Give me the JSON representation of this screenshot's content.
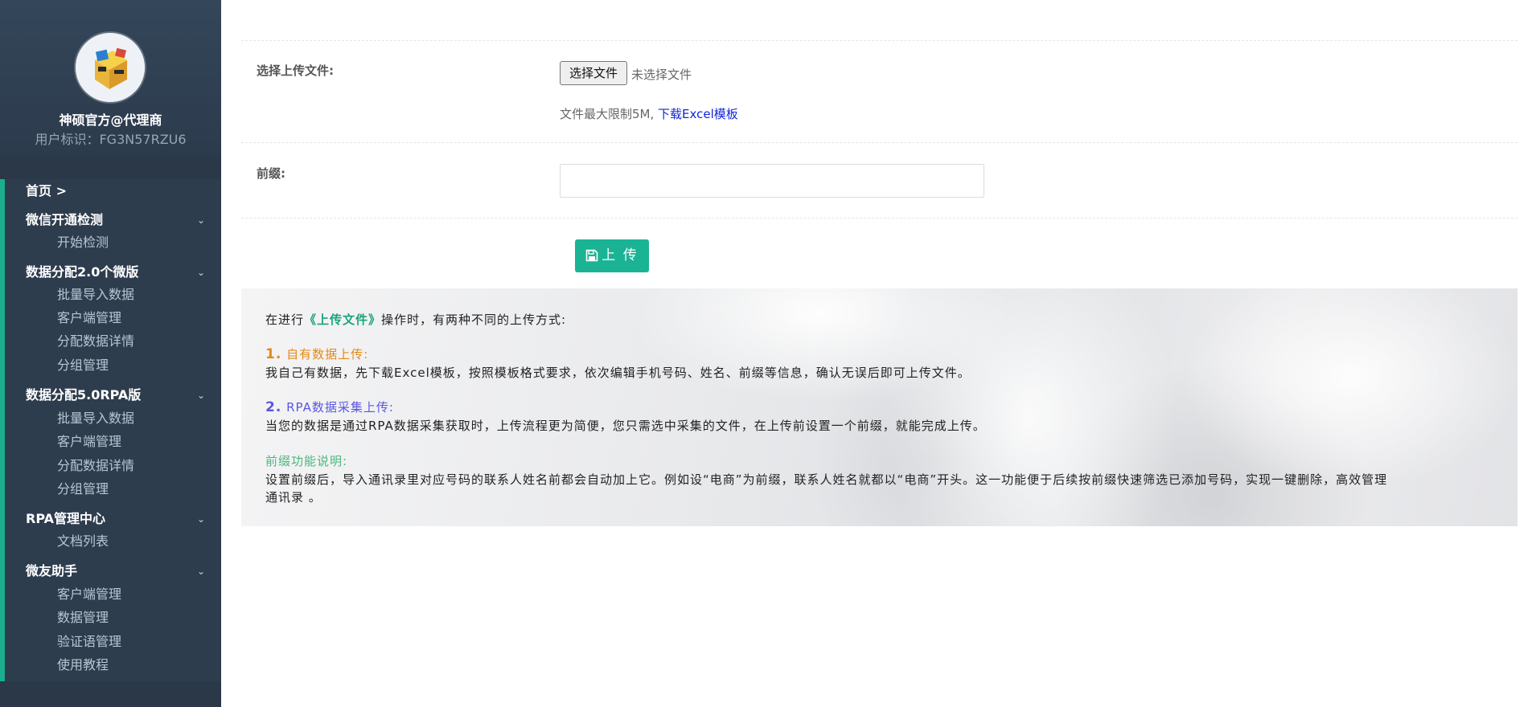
{
  "sidebar": {
    "profile": {
      "name": "神硕官方@代理商",
      "id_label": "用户标识：",
      "id_value": "FG3N57RZU6"
    },
    "home": "首页 >",
    "groups": [
      {
        "label": "微信开通检测",
        "items": [
          "开始检测"
        ]
      },
      {
        "label": "数据分配2.0个微版",
        "items": [
          "批量导入数据",
          "客户端管理",
          "分配数据详情",
          "分组管理"
        ]
      },
      {
        "label": "数据分配5.0RPA版",
        "items": [
          "批量导入数据",
          "客户端管理",
          "分配数据详情",
          "分组管理"
        ]
      },
      {
        "label": "RPA管理中心",
        "items": [
          "文档列表"
        ]
      },
      {
        "label": "微友助手",
        "items": [
          "客户端管理",
          "数据管理",
          "验证语管理",
          "使用教程"
        ]
      }
    ],
    "accent_color": "#1aae8f"
  },
  "form": {
    "file_label": "选择上传文件:",
    "file_button": "选择文件",
    "file_status": "未选择文件",
    "file_hint": "文件最大限制5M, ",
    "template_link": "下载Excel模板",
    "prefix_label": "前缀:",
    "prefix_value": "",
    "upload_button": "上 传"
  },
  "info": {
    "intro_before": "在进行",
    "intro_highlight": "《上传文件》",
    "intro_after": "操作时，有两种不同的上传方式:",
    "section1_num": "1.",
    "section1_title": " 自有数据上传:",
    "section1_body": "我自己有数据，先下载Excel模板，按照模板格式要求，依次编辑手机号码、姓名、前缀等信息，确认无误后即可上传文件。",
    "section2_num": "2.",
    "section2_title": " RPA数据采集上传:",
    "section2_body": "当您的数据是通过RPA数据采集获取时，上传流程更为简便，您只需选中采集的文件，在上传前设置一个前缀，就能完成上传。",
    "section3_title": "前缀功能说明:",
    "section3_body_line1": "设置前缀后，导入通讯录里对应号码的联系人姓名前都会自动加上它。例如设“电商”为前缀，联系人姓名就都以“电商”开头。这一功能便于后续按前缀快速筛选已添加号码，实现一键删除，高效管理",
    "section3_body_line2": "通讯录 。"
  },
  "icons": {
    "upload": "floppy-disk-icon",
    "chevron": "chevron-down-icon"
  }
}
